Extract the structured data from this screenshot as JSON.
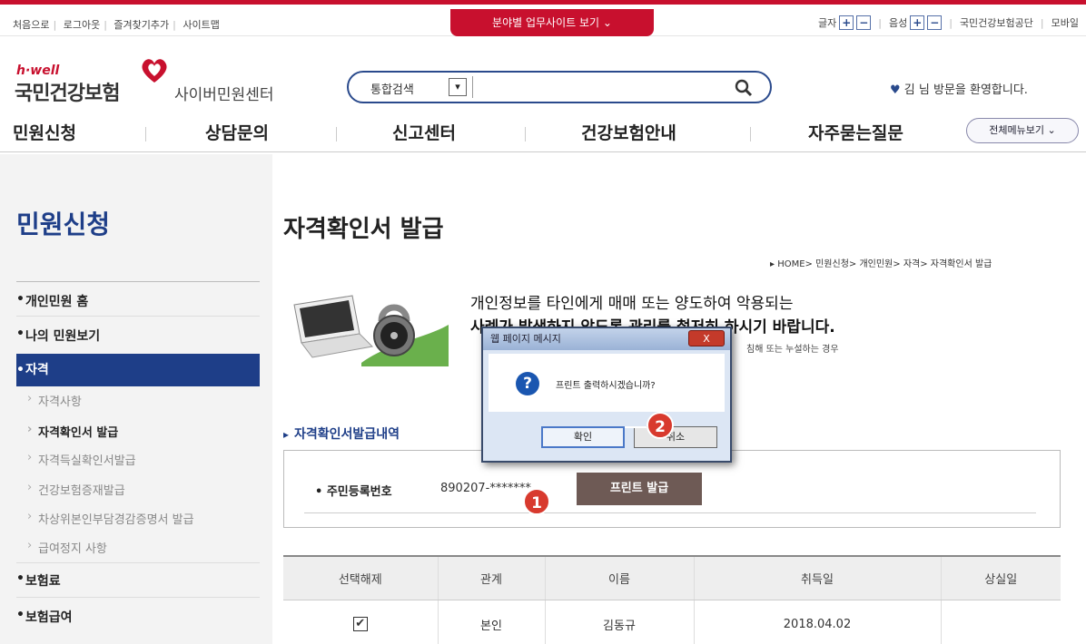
{
  "top_links": [
    "처음으로",
    "로그아웃",
    "즐겨찾기추가",
    "사이트맵"
  ],
  "partner_tab": "분야별 업무사이트 보기",
  "top_right": {
    "font_label": "글자",
    "voice_label": "음성",
    "org_name": "국민건강보험공단",
    "mobile": "모바일"
  },
  "logo": {
    "hwell": "h·well",
    "name": "국민건강보험",
    "sub": "사이버민원센터"
  },
  "search": {
    "label": "통합검색",
    "value": ""
  },
  "welcome": "김 님 방문을 환영합니다.",
  "gnb": [
    "민원신청",
    "상담문의",
    "신고센터",
    "건강보험안내",
    "자주묻는질문"
  ],
  "all_menu": "전체메뉴보기",
  "sidebar": {
    "title": "민원신청",
    "items": [
      {
        "label": "개인민원 홈"
      },
      {
        "label": "나의 민원보기"
      },
      {
        "label": "자격"
      }
    ],
    "subs": [
      {
        "label": "자격사항"
      },
      {
        "label": "자격확인서 발급"
      },
      {
        "label": "자격득실확인서발급"
      },
      {
        "label": "건강보험증재발급"
      },
      {
        "label": "차상위본인부담경감증명서 발급"
      },
      {
        "label": "급여정지 사항"
      }
    ],
    "items_bottom": [
      {
        "label": "보험료"
      },
      {
        "label": "보험급여"
      }
    ]
  },
  "main": {
    "title": "자격확인서 발급",
    "breadcrumb": "HOME> 민원신청> 개인민원> 자격> 자격확인서 발급",
    "notice_line1": "개인정보를 타인에게 매매 또는 양도하여 악용되는",
    "notice_line2": "사례가 발생하지 않도록 관리를 철저히 하시기 바랍니다.",
    "notice_small_right": "침해 또는 누설하는 경우",
    "section_title": "자격확인서발급내역",
    "id_label": "주민등록번호",
    "id_value": "890207-*******",
    "print_button": "프린트 발급"
  },
  "table": {
    "headers": [
      "선택해제",
      "관계",
      "이름",
      "취득일",
      "상실일"
    ],
    "rows": [
      {
        "checked": "✔",
        "relation": "본인",
        "name": "김동규",
        "acquired": "2018.04.02",
        "lost": ""
      }
    ]
  },
  "dialog": {
    "title": "웹 페이지 메시지",
    "close": "X",
    "message": "프린트 출력하시겠습니까?",
    "ok": "확인",
    "cancel": "취소"
  },
  "callouts": [
    "1",
    "2"
  ],
  "colors": {
    "brand_red": "#c8102e",
    "brand_blue": "#1e3e88",
    "print_button": "#6e5a55"
  }
}
